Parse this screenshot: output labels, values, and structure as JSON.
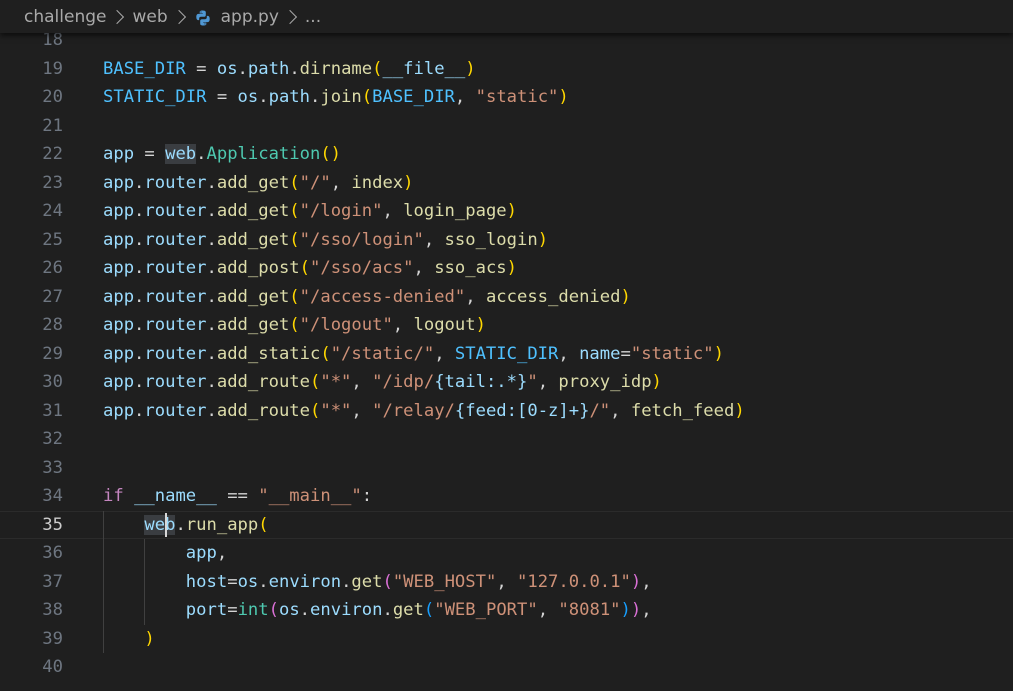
{
  "breadcrumb": {
    "items": [
      "challenge",
      "web",
      "app.py",
      "..."
    ],
    "file_icon": "python-icon"
  },
  "editor": {
    "current_line": 35,
    "lines": [
      {
        "number": "18",
        "tokens": []
      },
      {
        "number": "19",
        "tokens": [
          {
            "t": "BASE_DIR",
            "c": "tok-const"
          },
          {
            "t": " = ",
            "c": "tok-op"
          },
          {
            "t": "os",
            "c": "tok-var"
          },
          {
            "t": ".",
            "c": "tok-op"
          },
          {
            "t": "path",
            "c": "tok-var"
          },
          {
            "t": ".",
            "c": "tok-op"
          },
          {
            "t": "dirname",
            "c": "tok-fn"
          },
          {
            "t": "(",
            "c": "tok-b1"
          },
          {
            "t": "__file__",
            "c": "tok-var"
          },
          {
            "t": ")",
            "c": "tok-b1"
          }
        ]
      },
      {
        "number": "20",
        "tokens": [
          {
            "t": "STATIC_DIR",
            "c": "tok-const"
          },
          {
            "t": " = ",
            "c": "tok-op"
          },
          {
            "t": "os",
            "c": "tok-var"
          },
          {
            "t": ".",
            "c": "tok-op"
          },
          {
            "t": "path",
            "c": "tok-var"
          },
          {
            "t": ".",
            "c": "tok-op"
          },
          {
            "t": "join",
            "c": "tok-fn"
          },
          {
            "t": "(",
            "c": "tok-b1"
          },
          {
            "t": "BASE_DIR",
            "c": "tok-const"
          },
          {
            "t": ", ",
            "c": "tok-op"
          },
          {
            "t": "\"static\"",
            "c": "tok-str"
          },
          {
            "t": ")",
            "c": "tok-b1"
          }
        ]
      },
      {
        "number": "21",
        "tokens": []
      },
      {
        "number": "22",
        "tokens": [
          {
            "t": "app",
            "c": "tok-var"
          },
          {
            "t": " = ",
            "c": "tok-op"
          },
          {
            "t": "web",
            "c": "tok-var tok-hl"
          },
          {
            "t": ".",
            "c": "tok-op"
          },
          {
            "t": "Application",
            "c": "tok-class"
          },
          {
            "t": "()",
            "c": "tok-b1"
          }
        ]
      },
      {
        "number": "23",
        "tokens": [
          {
            "t": "app",
            "c": "tok-var"
          },
          {
            "t": ".",
            "c": "tok-op"
          },
          {
            "t": "router",
            "c": "tok-var"
          },
          {
            "t": ".",
            "c": "tok-op"
          },
          {
            "t": "add_get",
            "c": "tok-fn"
          },
          {
            "t": "(",
            "c": "tok-b1"
          },
          {
            "t": "\"/\"",
            "c": "tok-str"
          },
          {
            "t": ", ",
            "c": "tok-op"
          },
          {
            "t": "index",
            "c": "tok-fn"
          },
          {
            "t": ")",
            "c": "tok-b1"
          }
        ]
      },
      {
        "number": "24",
        "tokens": [
          {
            "t": "app",
            "c": "tok-var"
          },
          {
            "t": ".",
            "c": "tok-op"
          },
          {
            "t": "router",
            "c": "tok-var"
          },
          {
            "t": ".",
            "c": "tok-op"
          },
          {
            "t": "add_get",
            "c": "tok-fn"
          },
          {
            "t": "(",
            "c": "tok-b1"
          },
          {
            "t": "\"/login\"",
            "c": "tok-str"
          },
          {
            "t": ", ",
            "c": "tok-op"
          },
          {
            "t": "login_page",
            "c": "tok-fn"
          },
          {
            "t": ")",
            "c": "tok-b1"
          }
        ]
      },
      {
        "number": "25",
        "tokens": [
          {
            "t": "app",
            "c": "tok-var"
          },
          {
            "t": ".",
            "c": "tok-op"
          },
          {
            "t": "router",
            "c": "tok-var"
          },
          {
            "t": ".",
            "c": "tok-op"
          },
          {
            "t": "add_get",
            "c": "tok-fn"
          },
          {
            "t": "(",
            "c": "tok-b1"
          },
          {
            "t": "\"/sso/login\"",
            "c": "tok-str"
          },
          {
            "t": ", ",
            "c": "tok-op"
          },
          {
            "t": "sso_login",
            "c": "tok-fn"
          },
          {
            "t": ")",
            "c": "tok-b1"
          }
        ]
      },
      {
        "number": "26",
        "tokens": [
          {
            "t": "app",
            "c": "tok-var"
          },
          {
            "t": ".",
            "c": "tok-op"
          },
          {
            "t": "router",
            "c": "tok-var"
          },
          {
            "t": ".",
            "c": "tok-op"
          },
          {
            "t": "add_post",
            "c": "tok-fn"
          },
          {
            "t": "(",
            "c": "tok-b1"
          },
          {
            "t": "\"/sso/acs\"",
            "c": "tok-str"
          },
          {
            "t": ", ",
            "c": "tok-op"
          },
          {
            "t": "sso_acs",
            "c": "tok-fn"
          },
          {
            "t": ")",
            "c": "tok-b1"
          }
        ]
      },
      {
        "number": "27",
        "tokens": [
          {
            "t": "app",
            "c": "tok-var"
          },
          {
            "t": ".",
            "c": "tok-op"
          },
          {
            "t": "router",
            "c": "tok-var"
          },
          {
            "t": ".",
            "c": "tok-op"
          },
          {
            "t": "add_get",
            "c": "tok-fn"
          },
          {
            "t": "(",
            "c": "tok-b1"
          },
          {
            "t": "\"/access-denied\"",
            "c": "tok-str"
          },
          {
            "t": ", ",
            "c": "tok-op"
          },
          {
            "t": "access_denied",
            "c": "tok-fn"
          },
          {
            "t": ")",
            "c": "tok-b1"
          }
        ]
      },
      {
        "number": "28",
        "tokens": [
          {
            "t": "app",
            "c": "tok-var"
          },
          {
            "t": ".",
            "c": "tok-op"
          },
          {
            "t": "router",
            "c": "tok-var"
          },
          {
            "t": ".",
            "c": "tok-op"
          },
          {
            "t": "add_get",
            "c": "tok-fn"
          },
          {
            "t": "(",
            "c": "tok-b1"
          },
          {
            "t": "\"/logout\"",
            "c": "tok-str"
          },
          {
            "t": ", ",
            "c": "tok-op"
          },
          {
            "t": "logout",
            "c": "tok-fn"
          },
          {
            "t": ")",
            "c": "tok-b1"
          }
        ]
      },
      {
        "number": "29",
        "tokens": [
          {
            "t": "app",
            "c": "tok-var"
          },
          {
            "t": ".",
            "c": "tok-op"
          },
          {
            "t": "router",
            "c": "tok-var"
          },
          {
            "t": ".",
            "c": "tok-op"
          },
          {
            "t": "add_static",
            "c": "tok-fn"
          },
          {
            "t": "(",
            "c": "tok-b1"
          },
          {
            "t": "\"/static/\"",
            "c": "tok-str"
          },
          {
            "t": ", ",
            "c": "tok-op"
          },
          {
            "t": "STATIC_DIR",
            "c": "tok-const"
          },
          {
            "t": ", ",
            "c": "tok-op"
          },
          {
            "t": "name",
            "c": "tok-var"
          },
          {
            "t": "=",
            "c": "tok-op"
          },
          {
            "t": "\"static\"",
            "c": "tok-str"
          },
          {
            "t": ")",
            "c": "tok-b1"
          }
        ]
      },
      {
        "number": "30",
        "tokens": [
          {
            "t": "app",
            "c": "tok-var"
          },
          {
            "t": ".",
            "c": "tok-op"
          },
          {
            "t": "router",
            "c": "tok-var"
          },
          {
            "t": ".",
            "c": "tok-op"
          },
          {
            "t": "add_route",
            "c": "tok-fn"
          },
          {
            "t": "(",
            "c": "tok-b1"
          },
          {
            "t": "\"*\"",
            "c": "tok-str"
          },
          {
            "t": ", ",
            "c": "tok-op"
          },
          {
            "t": "\"/idp/",
            "c": "tok-str"
          },
          {
            "t": "{tail:.*}",
            "c": "tok-var"
          },
          {
            "t": "\"",
            "c": "tok-str"
          },
          {
            "t": ", ",
            "c": "tok-op"
          },
          {
            "t": "proxy_idp",
            "c": "tok-fn"
          },
          {
            "t": ")",
            "c": "tok-b1"
          }
        ]
      },
      {
        "number": "31",
        "tokens": [
          {
            "t": "app",
            "c": "tok-var"
          },
          {
            "t": ".",
            "c": "tok-op"
          },
          {
            "t": "router",
            "c": "tok-var"
          },
          {
            "t": ".",
            "c": "tok-op"
          },
          {
            "t": "add_route",
            "c": "tok-fn"
          },
          {
            "t": "(",
            "c": "tok-b1"
          },
          {
            "t": "\"*\"",
            "c": "tok-str"
          },
          {
            "t": ", ",
            "c": "tok-op"
          },
          {
            "t": "\"/relay/",
            "c": "tok-str"
          },
          {
            "t": "{feed:[0-z]+}",
            "c": "tok-var"
          },
          {
            "t": "/\"",
            "c": "tok-str"
          },
          {
            "t": ", ",
            "c": "tok-op"
          },
          {
            "t": "fetch_feed",
            "c": "tok-fn"
          },
          {
            "t": ")",
            "c": "tok-b1"
          }
        ]
      },
      {
        "number": "32",
        "tokens": []
      },
      {
        "number": "33",
        "tokens": []
      },
      {
        "number": "34",
        "tokens": [
          {
            "t": "if",
            "c": "tok-kw"
          },
          {
            "t": " ",
            "c": "tok-op"
          },
          {
            "t": "__name__",
            "c": "tok-var"
          },
          {
            "t": " == ",
            "c": "tok-op"
          },
          {
            "t": "\"__main__\"",
            "c": "tok-str"
          },
          {
            "t": ":",
            "c": "tok-op"
          }
        ]
      },
      {
        "number": "35",
        "tokens": [
          {
            "t": "    ",
            "c": "tok-op"
          },
          {
            "t": "web",
            "c": "tok-var tok-hl"
          },
          {
            "t": ".",
            "c": "tok-op"
          },
          {
            "t": "run_app",
            "c": "tok-fn"
          },
          {
            "t": "(",
            "c": "tok-b1"
          }
        ]
      },
      {
        "number": "36",
        "tokens": [
          {
            "t": "        ",
            "c": "tok-op"
          },
          {
            "t": "app",
            "c": "tok-var"
          },
          {
            "t": ",",
            "c": "tok-op"
          }
        ]
      },
      {
        "number": "37",
        "tokens": [
          {
            "t": "        ",
            "c": "tok-op"
          },
          {
            "t": "host",
            "c": "tok-var"
          },
          {
            "t": "=",
            "c": "tok-op"
          },
          {
            "t": "os",
            "c": "tok-var"
          },
          {
            "t": ".",
            "c": "tok-op"
          },
          {
            "t": "environ",
            "c": "tok-var"
          },
          {
            "t": ".",
            "c": "tok-op"
          },
          {
            "t": "get",
            "c": "tok-fn"
          },
          {
            "t": "(",
            "c": "tok-b2"
          },
          {
            "t": "\"WEB_HOST\"",
            "c": "tok-str"
          },
          {
            "t": ", ",
            "c": "tok-op"
          },
          {
            "t": "\"127.0.0.1\"",
            "c": "tok-str"
          },
          {
            "t": ")",
            "c": "tok-b2"
          },
          {
            "t": ",",
            "c": "tok-op"
          }
        ]
      },
      {
        "number": "38",
        "tokens": [
          {
            "t": "        ",
            "c": "tok-op"
          },
          {
            "t": "port",
            "c": "tok-var"
          },
          {
            "t": "=",
            "c": "tok-op"
          },
          {
            "t": "int",
            "c": "tok-class"
          },
          {
            "t": "(",
            "c": "tok-b2"
          },
          {
            "t": "os",
            "c": "tok-var"
          },
          {
            "t": ".",
            "c": "tok-op"
          },
          {
            "t": "environ",
            "c": "tok-var"
          },
          {
            "t": ".",
            "c": "tok-op"
          },
          {
            "t": "get",
            "c": "tok-fn"
          },
          {
            "t": "(",
            "c": "tok-b3"
          },
          {
            "t": "\"WEB_PORT\"",
            "c": "tok-str"
          },
          {
            "t": ", ",
            "c": "tok-op"
          },
          {
            "t": "\"8081\"",
            "c": "tok-str"
          },
          {
            "t": ")",
            "c": "tok-b3"
          },
          {
            "t": ")",
            "c": "tok-b2"
          },
          {
            "t": ",",
            "c": "tok-op"
          }
        ]
      },
      {
        "number": "39",
        "tokens": [
          {
            "t": "    ",
            "c": "tok-op"
          },
          {
            "t": ")",
            "c": "tok-b1"
          }
        ]
      },
      {
        "number": "40",
        "tokens": []
      }
    ]
  },
  "colors": {
    "background": "#1f1f1f",
    "line_number": "#6e7681",
    "current_line_number": "#cccccc",
    "variable": "#9cdcfe",
    "constant": "#4fc1ff",
    "function": "#dcdcaa",
    "string": "#ce9178",
    "keyword": "#c586c0",
    "class": "#4ec9b0",
    "bracket_1": "#ffd700",
    "bracket_2": "#da70d6",
    "bracket_3": "#179fff"
  }
}
